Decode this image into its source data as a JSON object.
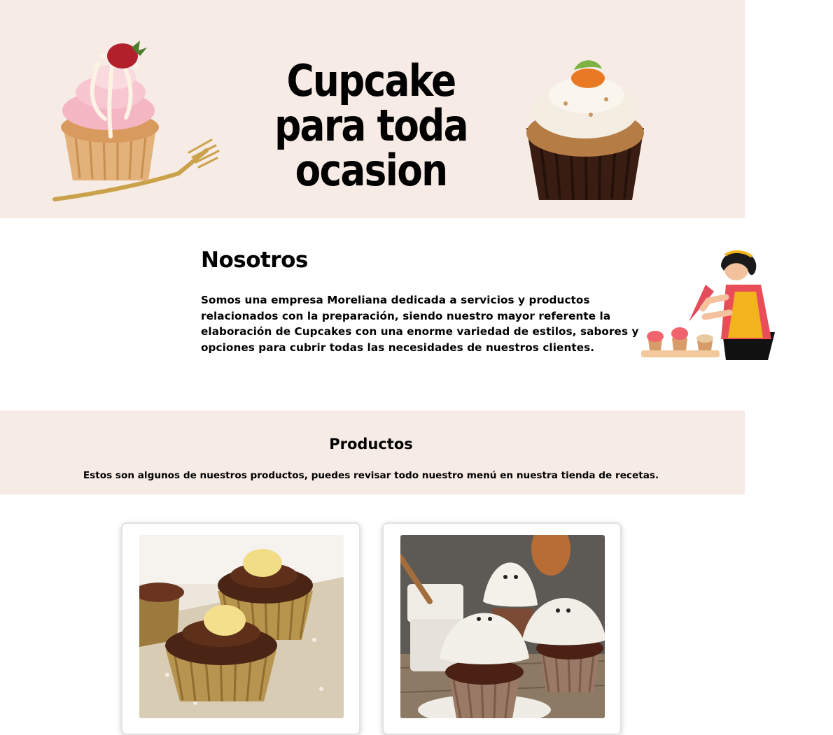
{
  "hero": {
    "title": "Cupcake para toda ocasion",
    "left_image_icon": "strawberry-cupcake-with-fork",
    "right_image_icon": "carrot-cupcake"
  },
  "about": {
    "title": "Nosotros",
    "text": "Somos una empresa Moreliana dedicada a servicios y productos relacionados con la preparación, siendo nuestro mayor referente la elaboración de Cupcakes con una enorme variedad de estilos, sabores y opciones para cubrir todas las necesidades de nuestros clientes.",
    "illustration_icon": "woman-decorating-cupcakes"
  },
  "products": {
    "title": "Productos",
    "subtitle": "Estos son algunos de nuestros productos, puedes revisar todo nuestro menú en nuestra tienda de recetas.",
    "cards": [
      {
        "image_icon": "chocolate-banana-cupcakes"
      },
      {
        "image_icon": "ghost-chocolate-cupcakes"
      }
    ]
  },
  "colors": {
    "band_background": "#f7ebe6",
    "page_background": "#ffffff",
    "text": "#000000"
  }
}
